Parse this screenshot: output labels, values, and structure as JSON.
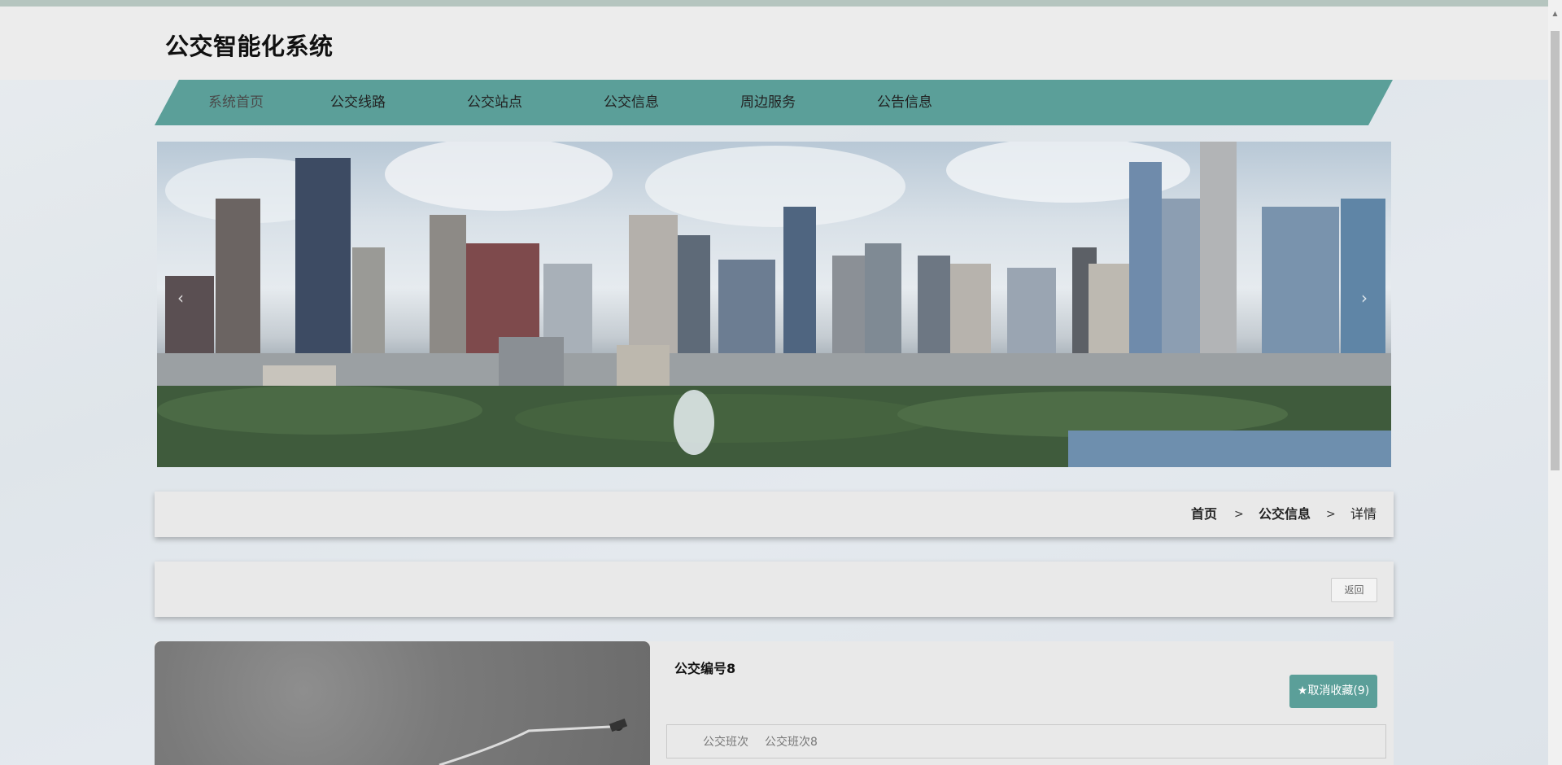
{
  "site": {
    "title": "公交智能化系统"
  },
  "nav": {
    "items": [
      {
        "label": "系统首页"
      },
      {
        "label": "公交线路"
      },
      {
        "label": "公交站点"
      },
      {
        "label": "公交信息"
      },
      {
        "label": "周边服务"
      },
      {
        "label": "公告信息"
      }
    ]
  },
  "banner": {
    "prev_label": "‹",
    "next_label": "›"
  },
  "breadcrumb": {
    "home": "首页",
    "section": "公交信息",
    "current": "详情",
    "separator": ">"
  },
  "actions": {
    "back_label": "返回"
  },
  "detail": {
    "name": "公交编号8",
    "favorite_label": "★取消收藏(9)",
    "fields": [
      {
        "label": "公交班次",
        "value": "公交班次8"
      }
    ]
  },
  "colors": {
    "accent": "#5b9f99",
    "header_bg": "#ececec",
    "card_bg": "#e9e9e9"
  }
}
